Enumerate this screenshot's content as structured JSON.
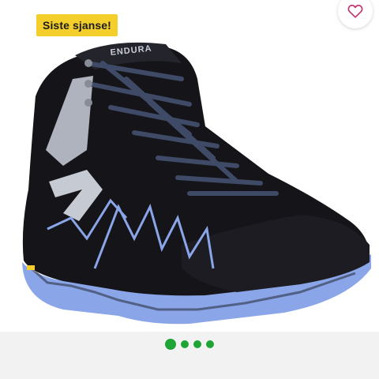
{
  "product": {
    "badge": "Siste sjanse!",
    "brand_mark": "ENDURA",
    "favorite_icon": "heart-outline-icon",
    "colors": {
      "badge_bg": "#f4cf2c",
      "dot": "#1fa535",
      "heart": "#c0316e",
      "sole_accent": "#8aa6e8",
      "boot_body": "#141419"
    }
  },
  "carousel": {
    "total": 4,
    "active": 1
  }
}
